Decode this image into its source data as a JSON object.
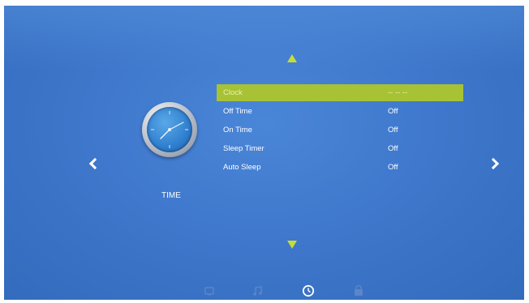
{
  "section": {
    "label": "TIME",
    "icon": "clock-icon"
  },
  "navigation": {
    "up_icon": "triangle-up-icon",
    "down_icon": "triangle-down-icon",
    "left_icon": "chevron-left-icon",
    "right_icon": "chevron-right-icon"
  },
  "menu": {
    "items": [
      {
        "label": "Clock",
        "value": "-- -- --",
        "selected": true
      },
      {
        "label": "Off Time",
        "value": "Off",
        "selected": false
      },
      {
        "label": "On Time",
        "value": "Off",
        "selected": false
      },
      {
        "label": "Sleep Timer",
        "value": "Off",
        "selected": false
      },
      {
        "label": "Auto Sleep",
        "value": "Off",
        "selected": false
      }
    ]
  },
  "bottom_tabs": [
    {
      "icon": "picture-icon",
      "active": false
    },
    {
      "icon": "sound-icon",
      "active": false
    },
    {
      "icon": "time-icon",
      "active": true
    },
    {
      "icon": "lock-icon",
      "active": false
    }
  ],
  "colors": {
    "background": "#3f78cc",
    "highlight": "#a7c234",
    "arrow": "#c6dc3a",
    "text": "#ffffff"
  }
}
